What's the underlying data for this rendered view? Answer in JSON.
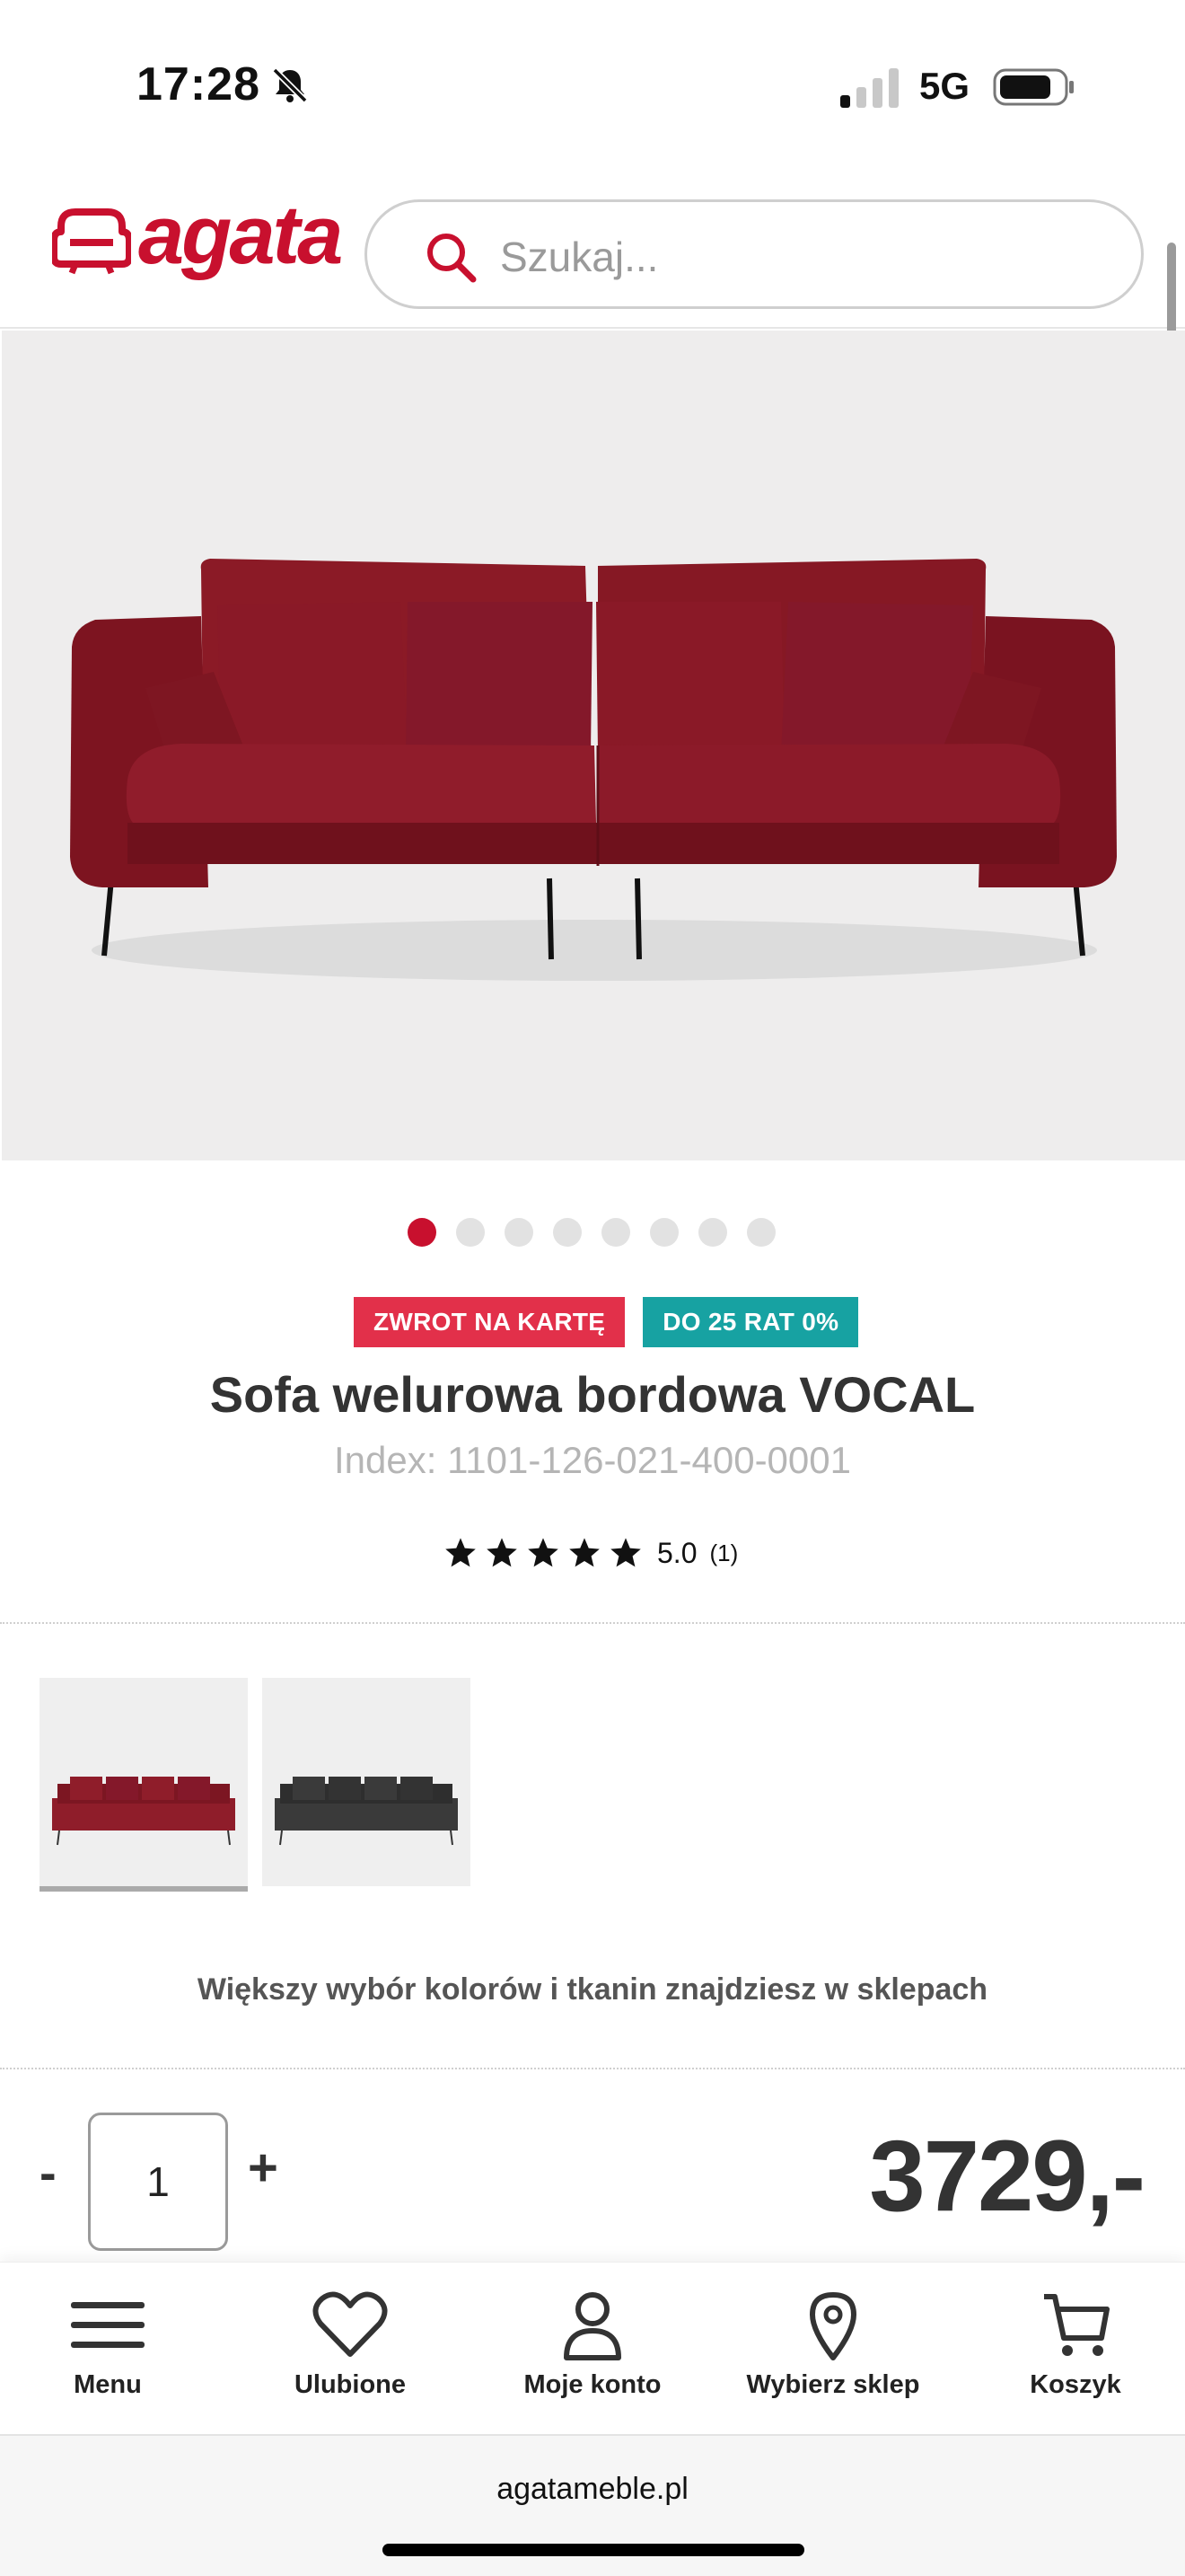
{
  "status_bar": {
    "time": "17:28",
    "network": "5G",
    "icons": [
      "bell-slash-icon",
      "signal-icon",
      "battery-icon"
    ]
  },
  "header": {
    "logo_text": "agata",
    "search_placeholder": "Szukaj..."
  },
  "gallery": {
    "dot_count": 8,
    "active_index": 0,
    "image": "red velvet sofa"
  },
  "badges": [
    {
      "label": "ZWROT NA KARTĘ",
      "color": "#e2304a"
    },
    {
      "label": "DO 25 RAT 0%",
      "color": "#17a2a2"
    }
  ],
  "product": {
    "title": "Sofa welurowa bordowa VOCAL",
    "index": "Index: 1101-126-021-400-0001",
    "rating_value": "5.0",
    "rating_count": "(1)",
    "stars": 5
  },
  "variants": [
    {
      "color_name": "bordowa",
      "swatch": "#8f1d2a",
      "selected": true
    },
    {
      "color_name": "grafitowa",
      "swatch": "#3a3a3a",
      "selected": false
    }
  ],
  "more_colors_text": "Większy wybór kolorów i tkanin znajdziesz w sklepach",
  "purchase": {
    "minus": "-",
    "quantity": "1",
    "plus": "+",
    "price": "3729,-"
  },
  "bottom_nav": [
    {
      "label": "Menu",
      "icon": "menu-icon"
    },
    {
      "label": "Ulubione",
      "icon": "heart-icon"
    },
    {
      "label": "Moje konto",
      "icon": "user-icon"
    },
    {
      "label": "Wybierz sklep",
      "icon": "location-pin-icon"
    },
    {
      "label": "Koszyk",
      "icon": "cart-icon"
    }
  ],
  "browser": {
    "url": "agatameble.pl"
  },
  "colors": {
    "brand": "#c8102e",
    "teal": "#17a2a2",
    "badge_red": "#e2304a"
  }
}
